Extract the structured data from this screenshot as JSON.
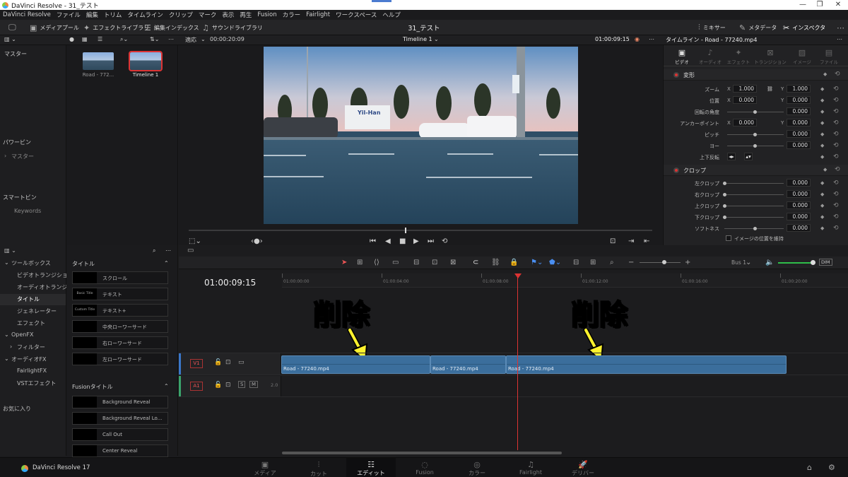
{
  "window": {
    "title": "DaVinci Resolve - 31_テスト",
    "controls": [
      "—",
      "❐",
      "✕"
    ]
  },
  "menu": [
    "DaVinci Resolve",
    "ファイル",
    "編集",
    "トリム",
    "タイムライン",
    "クリップ",
    "マーク",
    "表示",
    "再生",
    "Fusion",
    "カラー",
    "Fairlight",
    "ワークスペース",
    "ヘルプ"
  ],
  "toolbar": {
    "media_pool": "メディアプール",
    "effects_library": "エフェクトライブラリ",
    "edit_index": "編集インデックス",
    "sound_library": "サウンドライブラリ",
    "project_name": "31_テスト",
    "mixer": "ミキサー",
    "metadata": "メタデータ",
    "inspector": "インスペクタ"
  },
  "viewer": {
    "fit": "適応",
    "source_tc": "00:00:20:09",
    "timeline_name": "Timeline 1",
    "record_tc": "01:00:09:15"
  },
  "bins": {
    "master": "マスター",
    "power_bin": "パワービン",
    "power_master": "マスター",
    "smart_bin": "スマートビン",
    "keywords": "Keywords"
  },
  "media": [
    {
      "caption": "Road - 772...",
      "selected": false
    },
    {
      "caption": "Timeline 1",
      "selected": true
    }
  ],
  "inspector": {
    "header": "タイムライン - Road - 77240.mp4",
    "tabs": [
      "ビデオ",
      "オーディオ",
      "エフェクト",
      "トランジション",
      "イメージ",
      "ファイル"
    ],
    "transform_title": "変形",
    "crop_title": "クロップ",
    "params": [
      {
        "label": "ズーム",
        "x": "1.000",
        "y": "1.000"
      },
      {
        "label": "位置",
        "x": "0.000",
        "y": "0.000"
      },
      {
        "label": "回転の角度",
        "v": "0.000"
      },
      {
        "label": "アンカーポイント",
        "x": "0.000",
        "y": "0.000"
      },
      {
        "label": "ピッチ",
        "v": "0.000"
      },
      {
        "label": "ヨー",
        "v": "0.000"
      },
      {
        "label": "上下反転"
      }
    ],
    "crop": [
      {
        "label": "左クロップ",
        "v": "0.000"
      },
      {
        "label": "右クロップ",
        "v": "0.000"
      },
      {
        "label": "上クロップ",
        "v": "0.000"
      },
      {
        "label": "下クロップ",
        "v": "0.000"
      },
      {
        "label": "ソフトネス",
        "v": "0.000"
      }
    ],
    "retain_image_pos": "イメージの位置を維持",
    "axis_x": "X",
    "axis_y": "Y"
  },
  "fxtree": {
    "toolbox": "ツールボックス",
    "video_transitions": "ビデオトランジション",
    "audio_transitions": "オーディオトランジシ...",
    "titles": "タイトル",
    "generators": "ジェネレーター",
    "effects": "エフェクト",
    "openfx": "OpenFX",
    "filters": "フィルター",
    "audiofx": "オーディオFX",
    "fairlightfx": "FairlightFX",
    "vst": "VSTエフェクト",
    "favorites": "お気に入り"
  },
  "fxgrid": {
    "titles_head": "タイトル",
    "fusion_head": "Fusionタイトル",
    "titles": [
      {
        "preview": "",
        "name": "スクロール"
      },
      {
        "preview": "Basic Title",
        "name": "テキスト"
      },
      {
        "preview": "Custom Title",
        "name": "テキスト+"
      },
      {
        "preview": "",
        "name": "中央ローワーサード"
      },
      {
        "preview": "",
        "name": "右ローワーサード"
      },
      {
        "preview": "",
        "name": "左ローワーサード"
      }
    ],
    "fusion": [
      {
        "preview": "",
        "name": "Background Reveal"
      },
      {
        "preview": "",
        "name": "Background Reveal Lo..."
      },
      {
        "preview": "",
        "name": "Call Out"
      },
      {
        "preview": "",
        "name": "Center Reveal"
      }
    ]
  },
  "timeline": {
    "timecode": "01:00:09:15",
    "ruler": [
      "01:00:00:00",
      "01:00:04:00",
      "01:00:08:00",
      "01:00:12:00",
      "01:00:16:00",
      "01:00:20:00"
    ],
    "v1": "V1",
    "a1": "A1",
    "a1_level": "2.0",
    "bus": "Bus 1",
    "dim": "DIM",
    "clips": [
      {
        "name": "Road - 77240.mp4"
      },
      {
        "name": "Road - 77240.mp4"
      },
      {
        "name": "Road - 77240.mp4"
      }
    ],
    "annotation_left": "削除",
    "annotation_right": "削除"
  },
  "pages": {
    "app": "DaVinci Resolve 17",
    "items": [
      "メディア",
      "カット",
      "エディット",
      "Fusion",
      "カラー",
      "Fairlight",
      "デリバー"
    ],
    "active": "エディット"
  },
  "colors": {
    "accent_red": "#d33333",
    "clip_blue": "#3b6e9c",
    "annotation_yellow": "#fff22e"
  }
}
